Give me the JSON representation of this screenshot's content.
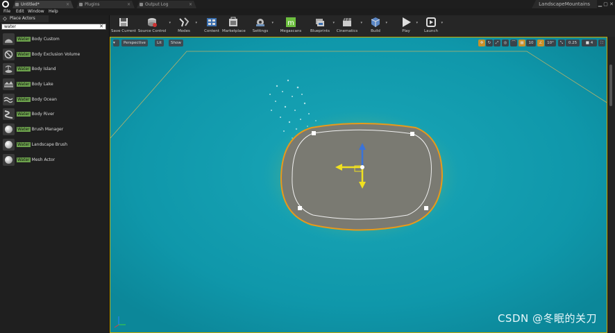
{
  "window": {
    "tabs": [
      {
        "label": "Untitled*",
        "active": true
      },
      {
        "label": "Plugins",
        "active": false
      },
      {
        "label": "Output Log",
        "active": false
      }
    ],
    "project_name": "LandscapeMountains"
  },
  "menu": [
    "File",
    "Edit",
    "Window",
    "Help"
  ],
  "panel": {
    "title": "Place Actors",
    "search_value": "water",
    "items": [
      {
        "highlight": "Water",
        "rest": " Body Custom",
        "icon": "water-body-custom-icon"
      },
      {
        "highlight": "Water",
        "rest": " Body Exclusion Volume",
        "icon": "exclusion-volume-icon"
      },
      {
        "highlight": "Water",
        "rest": " Body Island",
        "icon": "island-icon"
      },
      {
        "highlight": "Water",
        "rest": " Body Lake",
        "icon": "lake-icon"
      },
      {
        "highlight": "Water",
        "rest": " Body Ocean",
        "icon": "ocean-icon"
      },
      {
        "highlight": "Water",
        "rest": " Body River",
        "icon": "river-icon"
      },
      {
        "highlight": "Water",
        "rest": " Brush Manager",
        "icon": "sphere-icon"
      },
      {
        "highlight": "Water",
        "rest": " Landscape Brush",
        "icon": "sphere-icon"
      },
      {
        "highlight": "Water",
        "rest": " Mesh Actor",
        "icon": "sphere-icon"
      }
    ]
  },
  "toolbar": {
    "buttons": [
      {
        "label": "Save Current",
        "icon": "save-icon"
      },
      {
        "label": "Source Control",
        "icon": "source-control-icon"
      },
      {
        "label": "Modes",
        "icon": "modes-icon"
      },
      {
        "label": "Content",
        "icon": "content-icon"
      },
      {
        "label": "Marketplace",
        "icon": "marketplace-icon"
      },
      {
        "label": "Settings",
        "icon": "settings-icon"
      },
      {
        "label": "Megascans",
        "icon": "megascans-icon"
      },
      {
        "label": "Blueprints",
        "icon": "blueprints-icon"
      },
      {
        "label": "Cinematics",
        "icon": "cinematics-icon"
      },
      {
        "label": "Build",
        "icon": "build-icon"
      },
      {
        "label": "Play",
        "icon": "play-icon"
      },
      {
        "label": "Launch",
        "icon": "launch-icon"
      }
    ]
  },
  "viewport": {
    "perspective_label": "Perspective",
    "lit_label": "Lit",
    "show_label": "Show",
    "grid_snap": "10",
    "rotation_snap": "10°",
    "scale_snap": "0.25",
    "camera_speed": "4",
    "colors": {
      "water": "#12a0b4",
      "selection": "#e89a1a",
      "island": "#7a7a72"
    }
  },
  "watermark": "CSDN @冬眠的关刀"
}
